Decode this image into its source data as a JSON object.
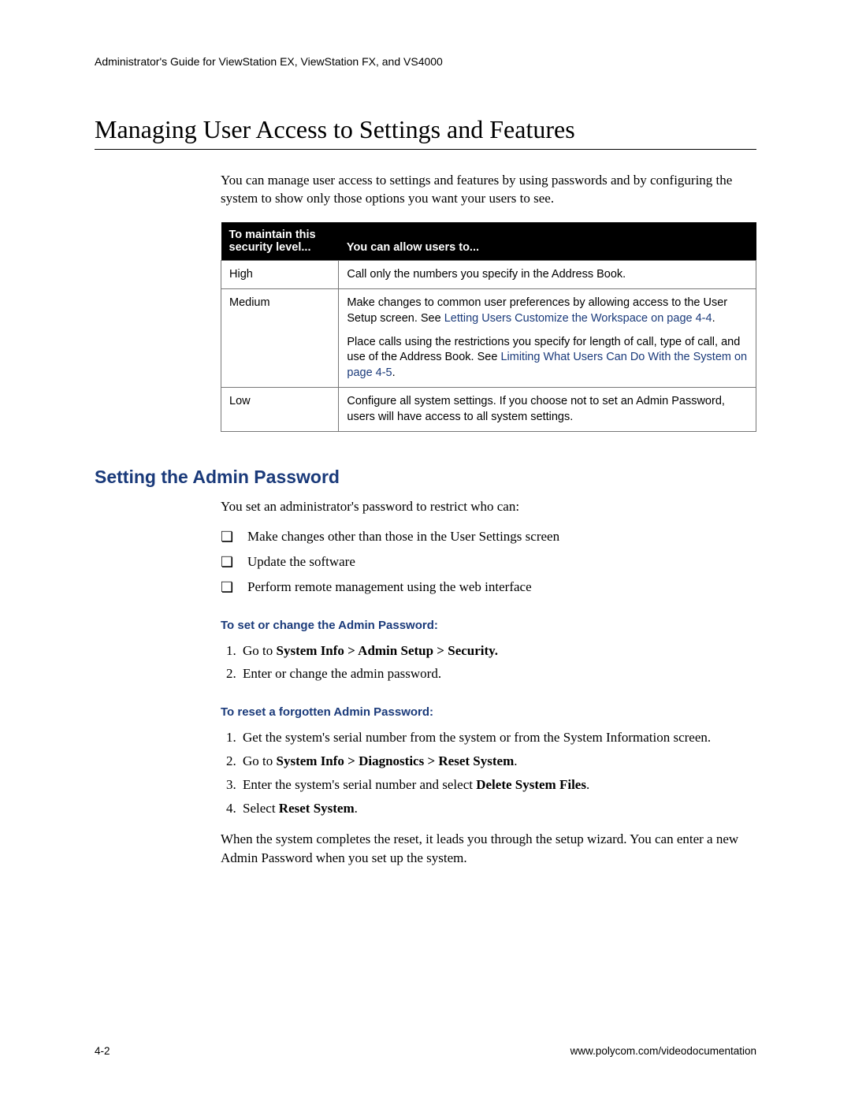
{
  "header": "Administrator's Guide for ViewStation EX, ViewStation FX, and VS4000",
  "title": "Managing User Access to Settings and Features",
  "intro": "You can manage user access to settings and features by using passwords and by configuring the system to show only those options you want your users to see.",
  "table": {
    "col1": "To maintain this security level...",
    "col2": "You can allow users to...",
    "rows": {
      "high": {
        "level": "High",
        "text": "Call only the numbers you specify in the Address Book."
      },
      "medium": {
        "level": "Medium",
        "p1a": "Make changes to common user preferences by allowing access to the User Setup screen. See ",
        "p1link": "Letting Users Customize the Workspace on page 4-4",
        "p1b": ".",
        "p2a": "Place calls using the restrictions you specify for length of call, type of call, and use of the Address Book. See ",
        "p2link": "Limiting What Users Can Do With the System on page 4-5",
        "p2b": "."
      },
      "low": {
        "level": "Low",
        "text": "Configure all system settings. If you choose not to set an Admin Password, users will have access to all system settings."
      }
    }
  },
  "section2": {
    "title": "Setting the Admin Password",
    "lead": "You set an administrator's password to restrict who can:",
    "bullets": {
      "b1": "Make changes other than those in the User Settings screen",
      "b2": "Update the software",
      "b3": "Perform remote management using the web interface"
    },
    "proc1": {
      "title": "To set or change the Admin Password:",
      "s1a": "Go to ",
      "s1b": "System Info > Admin Setup > Security.",
      "s2": "Enter or change the admin password."
    },
    "proc2": {
      "title": "To reset a forgotten Admin Password:",
      "s1": "Get the system's serial number from the system or from the System Information screen.",
      "s2a": "Go to ",
      "s2b": "System Info > Diagnostics > Reset System",
      "s2c": ".",
      "s3a": "Enter the system's serial number and select ",
      "s3b": "Delete System Files",
      "s3c": ".",
      "s4a": "Select ",
      "s4b": "Reset System",
      "s4c": "."
    },
    "closing": "When the system completes the reset, it leads you through the setup wizard. You can enter a new Admin Password when you set up the system."
  },
  "footer": {
    "left": "4-2",
    "right": "www.polycom.com/videodocumentation"
  }
}
